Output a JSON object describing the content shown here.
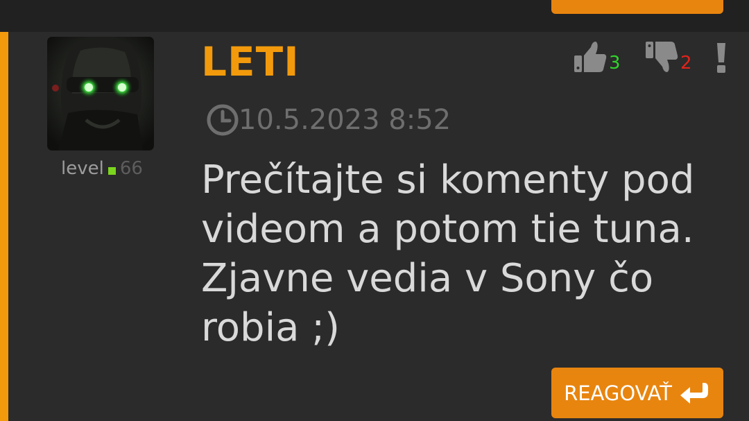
{
  "comment": {
    "username": "LETI",
    "timestamp": "10.5.2023 8:52",
    "text": "Prečítajte si komenty pod videom a potom tie tuna. Zjavne vedia v Sony čo robia ;)",
    "level_label": "level",
    "level_value": "66",
    "likes": "3",
    "dislikes": "2",
    "reply_label": "REAGOVAŤ"
  },
  "icons": {
    "clock": "clock-icon",
    "thumbs_up": "thumbs-up-icon",
    "thumbs_down": "thumbs-down-icon",
    "report": "exclamation-icon",
    "reply": "reply-arrow-icon"
  },
  "colors": {
    "accent": "#f29a0c",
    "button": "#e8850f",
    "like": "#2fd52b",
    "dislike": "#e2231a",
    "level_dot": "#7bd51e",
    "card_bg": "#2b2b2b"
  }
}
